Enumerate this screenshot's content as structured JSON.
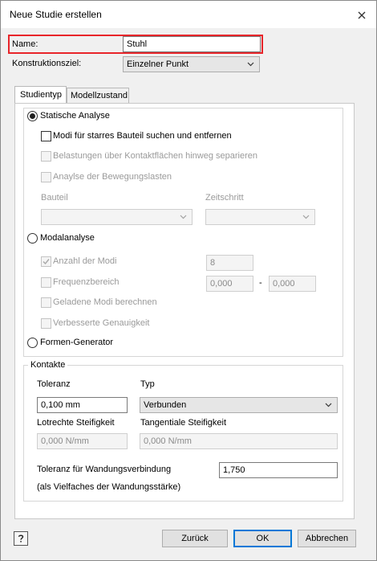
{
  "window": {
    "title": "Neue Studie erstellen"
  },
  "form": {
    "name_label": "Name:",
    "name_value": "Stuhl",
    "goal_label": "Konstruktionsziel:",
    "goal_value": "Einzelner Punkt"
  },
  "tabs": [
    {
      "label": "Studientyp",
      "active": true
    },
    {
      "label": "Modellzustand",
      "active": false
    }
  ],
  "studientyp": {
    "static_label": "Statische Analyse",
    "rigid_label": "Modi für starres Bauteil suchen und entfernen",
    "loads_label": "Belastungen über Kontaktflächen hinweg separieren",
    "motion_label": "Anaylse der Bewegungslasten",
    "part_label": "Bauteil",
    "time_label": "Zeitschritt",
    "modal_label": "Modalanalyse",
    "modes_count_label": "Anzahl der Modi",
    "modes_count_value": "8",
    "freq_label": "Frequenzbereich",
    "freq_from": "0,000",
    "freq_sep": "-",
    "freq_to": "0,000",
    "loaded_label": "Geladene Modi berechnen",
    "accuracy_label": "Verbesserte Genauigkeit",
    "shape_label": "Formen-Generator"
  },
  "contacts": {
    "title": "Kontakte",
    "tolerance_label": "Toleranz",
    "tolerance_value": "0,100 mm",
    "type_label": "Typ",
    "type_value": "Verbunden",
    "normal_stiff_label": "Lotrechte Steifigkeit",
    "normal_stiff_value": "0,000 N/mm",
    "tangent_stiff_label": "Tangentiale Steifigkeit",
    "tangent_stiff_value": "0,000 N/mm",
    "shell_tol_label": "Toleranz für Wandungsverbindung",
    "shell_tol_value": "1,750",
    "shell_tol_note": "(als Vielfaches der Wandungsstärke)"
  },
  "buttons": {
    "back": "Zurück",
    "ok": "OK",
    "cancel": "Abbrechen"
  },
  "colors": {
    "highlight": "#e8252a",
    "accent": "#0078d7",
    "dialog_bg": "#f0f0f0"
  }
}
